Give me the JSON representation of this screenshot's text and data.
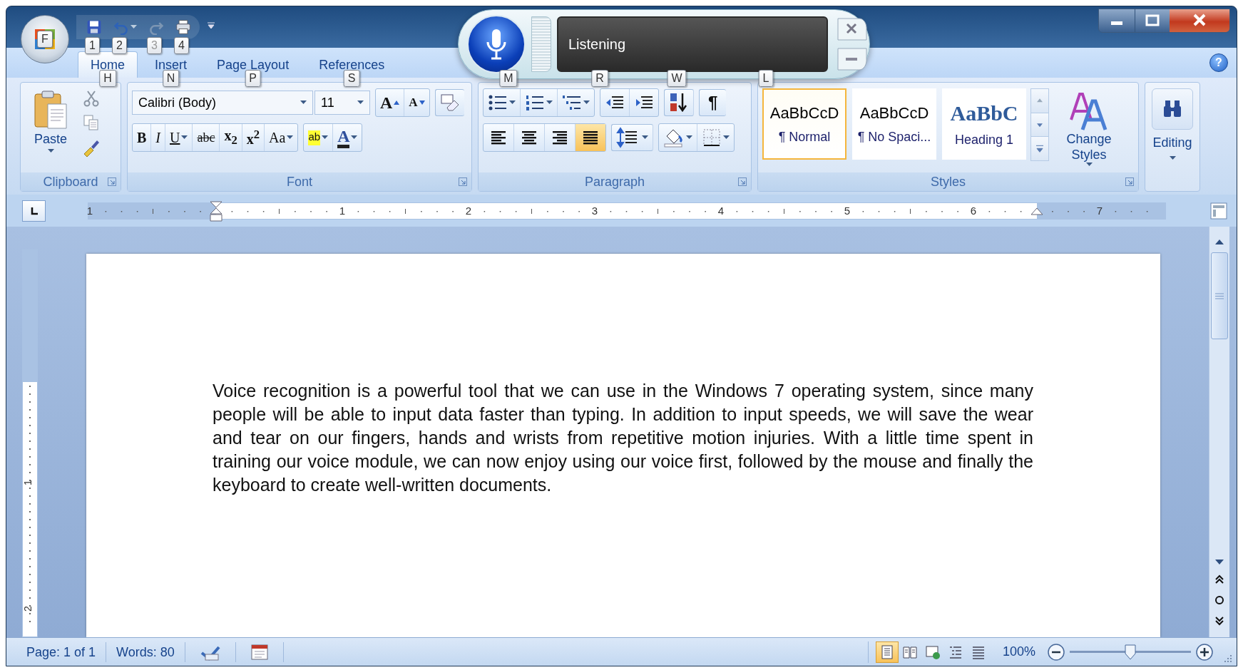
{
  "title_bar": {
    "office_button": {
      "keytip": "F"
    },
    "quick_access": [
      {
        "kind": "save",
        "keytip": "1",
        "disabled": false
      },
      {
        "kind": "undo",
        "keytip": "2",
        "disabled": false
      },
      {
        "kind": "redo",
        "keytip": "3",
        "disabled": true
      },
      {
        "kind": "print",
        "keytip": "4",
        "disabled": false
      }
    ]
  },
  "tabs": [
    {
      "label": "Home",
      "keytip": "H",
      "selected": true
    },
    {
      "label": "Insert",
      "keytip": "N",
      "selected": false
    },
    {
      "label": "Page Layout",
      "keytip": "P",
      "selected": false
    },
    {
      "label": "References",
      "keytip": "S",
      "selected": false
    }
  ],
  "help_button": "?",
  "speech_bar": {
    "status": "Listening",
    "keytips": [
      "M",
      "R",
      "W",
      "L"
    ]
  },
  "ribbon": {
    "clipboard": {
      "label": "Clipboard",
      "paste": "Paste"
    },
    "font": {
      "label": "Font",
      "font_name": "Calibri (Body)",
      "font_size": "11",
      "grow": "A",
      "shrink": "A",
      "format_buttons": [
        {
          "kind": "bold",
          "label": "B"
        },
        {
          "kind": "italic",
          "label": "I"
        },
        {
          "kind": "underline",
          "label": "U"
        },
        {
          "kind": "strike",
          "label": "abc"
        },
        {
          "kind": "subscript",
          "label": "x$_{2}$"
        },
        {
          "kind": "superscript",
          "label": "x$^{2}$"
        },
        {
          "kind": "case",
          "label": "Aa"
        }
      ],
      "highlight": "ab",
      "font_color": "A"
    },
    "paragraph": {
      "label": "Paragraph",
      "show_marks": "¶",
      "alignment": [
        {
          "kind": "left",
          "selected": false
        },
        {
          "kind": "center",
          "selected": false
        },
        {
          "kind": "right",
          "selected": false
        },
        {
          "kind": "justify",
          "selected": true
        }
      ]
    },
    "styles": {
      "label": "Styles",
      "gallery": [
        {
          "preview": "AaBbCcD",
          "name": "¶ Normal",
          "kind": "body",
          "selected": true
        },
        {
          "preview": "AaBbCcD",
          "name": "¶ No Spaci...",
          "kind": "body",
          "selected": false
        },
        {
          "preview": "AaBbC",
          "name": "Heading 1",
          "kind": "heading",
          "selected": false
        }
      ],
      "change_styles": "Change Styles"
    },
    "editing": {
      "label": "Editing"
    }
  },
  "ruler": {
    "numbers": [
      "1",
      "1",
      "2",
      "3",
      "4",
      "5",
      "6",
      "7"
    ]
  },
  "vertical_ruler": {
    "numbers": [
      "1",
      "2"
    ]
  },
  "document": {
    "text": "Voice recognition is a powerful tool that we can use in the Windows 7 operating system, since many people will be able to input data faster than typing. In addition to input speeds, we will save the wear and tear on our fingers, hands and wrists from repetitive motion injuries. With a little time spent in training our voice module, we can now enjoy using our voice first, followed by the mouse and finally the keyboard to create well-written documents."
  },
  "status_bar": {
    "page": "Page: 1 of 1",
    "words": "Words: 80",
    "views": [
      {
        "kind": "print",
        "selected": true
      },
      {
        "kind": "reading",
        "selected": false
      },
      {
        "kind": "web",
        "selected": false
      },
      {
        "kind": "outline",
        "selected": false
      },
      {
        "kind": "draft",
        "selected": false
      }
    ],
    "zoom": "100%",
    "zoom_slider": {
      "level": 0.5
    }
  }
}
